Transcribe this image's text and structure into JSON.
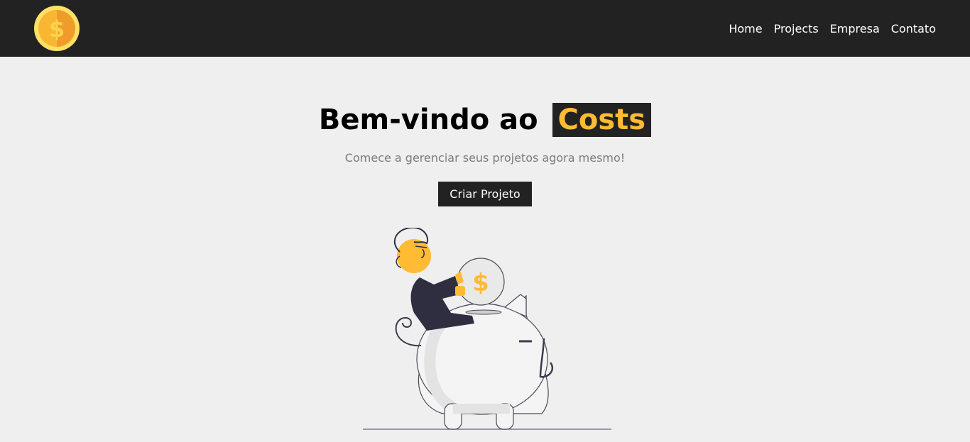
{
  "navbar": {
    "logo_icon": "dollar-coin-icon",
    "links": [
      {
        "label": "Home"
      },
      {
        "label": "Projects"
      },
      {
        "label": "Empresa"
      },
      {
        "label": "Contato"
      }
    ]
  },
  "hero": {
    "title_prefix": "Bem-vindo ao",
    "title_brand": "Costs",
    "subtitle": "Comece a gerenciar seus projetos agora mesmo!",
    "cta_label": "Criar Projeto",
    "illustration_coin_symbol": "$",
    "illustration_icon": "piggy-bank-savings-illustration"
  },
  "colors": {
    "nav_bg": "#222222",
    "page_bg": "#efefef",
    "accent": "#ffbb33",
    "text_muted": "#7b7b7b"
  }
}
